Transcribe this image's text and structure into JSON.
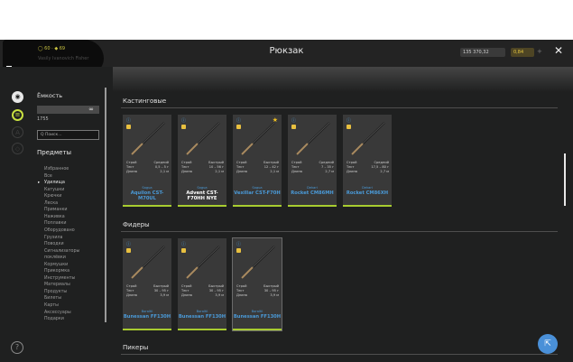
{
  "header": {
    "title": "Рюкзак",
    "level_text": "◯ 60 · ◆ 69",
    "player_name": "Vasily Ivanovich Fisher",
    "silver": "135 370,32",
    "gold": "0,84",
    "plus": "+",
    "close": "✕"
  },
  "rail": {
    "icon1": "◉",
    "icon2": "≡",
    "icon3": "A",
    "icon4": "◇",
    "help": "?"
  },
  "sidebar": {
    "capacity_label": "Ёмкость",
    "capacity_value": "∞",
    "capacity_count": "1755",
    "search_placeholder": "Q Поиск...",
    "items_title": "Предметы",
    "categories": [
      "Избранное",
      "Все",
      "Удилища",
      "Катушки",
      "Крючки",
      "Леска",
      "Приманки",
      "Наживка",
      "Поплавки",
      "Оборудовано",
      "Грузила",
      "Поводки",
      "Сигнализаторы",
      "поклёвки",
      "Кормушки",
      "Прикормка",
      "Инструменты",
      "Материалы",
      "Продукты",
      "Билеты",
      "Карты",
      "Аксессуары",
      "Подарки"
    ],
    "active_category": "Удилища"
  },
  "sections": [
    {
      "title": "Кастинговые",
      "cards": [
        {
          "brand": "Sagua",
          "model": "Aquilon CST-M70UL",
          "favorite": false,
          "white": false,
          "stats": [
            [
              "Строй",
              "Средний"
            ],
            [
              "Тест",
              "0,5 – 5 г"
            ],
            [
              "Длина",
              "2,1 м"
            ]
          ]
        },
        {
          "brand": "Sagua",
          "model": "Advent CST-F70HH NYE",
          "favorite": false,
          "white": true,
          "stats": [
            [
              "Строй",
              "Быстрый"
            ],
            [
              "Тест",
              "10 – 56 г"
            ],
            [
              "Длина",
              "2,1 м"
            ]
          ]
        },
        {
          "brand": "Sagua",
          "model": "Vexillar CST-F70H",
          "favorite": true,
          "white": false,
          "stats": [
            [
              "Строй",
              "Быстрый"
            ],
            [
              "Тест",
              "12 – 42 г"
            ],
            [
              "Длина",
              "2,1 м"
            ]
          ]
        },
        {
          "brand": "Dekari",
          "model": "Rocket CM86MH",
          "favorite": false,
          "white": false,
          "stats": [
            [
              "Строй",
              "Средний"
            ],
            [
              "Тест",
              "7 – 35 г"
            ],
            [
              "Длина",
              "2,7 м"
            ]
          ]
        },
        {
          "brand": "Dekari",
          "model": "Rocket CM86XH",
          "favorite": false,
          "white": false,
          "stats": [
            [
              "Строй",
              "Средний"
            ],
            [
              "Тест",
              "17,5 – 80 г"
            ],
            [
              "Длина",
              "2,7 м"
            ]
          ]
        }
      ]
    },
    {
      "title": "Фидеры",
      "cards": [
        {
          "brand": "Boraltil",
          "model": "Bunessan FF130H",
          "favorite": false,
          "white": false,
          "stats": [
            [
              "Строй",
              "Быстрый"
            ],
            [
              "Тест",
              "30 – 95 г"
            ],
            [
              "Длина",
              "3,9 м"
            ]
          ]
        },
        {
          "brand": "Boraltil",
          "model": "Bunessan FF130H",
          "favorite": false,
          "white": false,
          "stats": [
            [
              "Строй",
              "Быстрый"
            ],
            [
              "Тест",
              "30 – 95 г"
            ],
            [
              "Длина",
              "3,9 м"
            ]
          ]
        },
        {
          "brand": "Boraltil",
          "model": "Bunessan FF130H",
          "favorite": false,
          "white": false,
          "stats": [
            [
              "Строй",
              "Быстрый"
            ],
            [
              "Тест",
              "30 – 95 г"
            ],
            [
              "Длина",
              "3,9 м"
            ]
          ]
        }
      ]
    },
    {
      "title": "Пикеры",
      "cards": []
    }
  ],
  "fab_icon": "⇱"
}
